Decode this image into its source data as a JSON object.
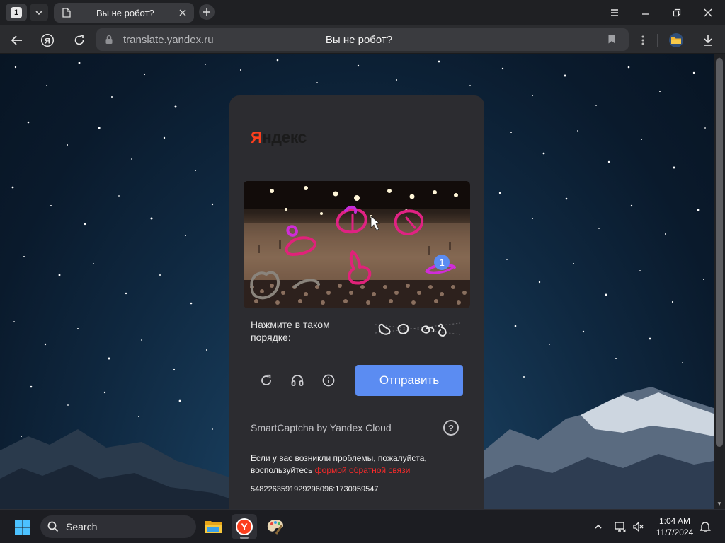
{
  "browser": {
    "tab_count": "1",
    "tab_title": "Вы не робот?",
    "url": "translate.yandex.ru",
    "page_heading": "Вы не робот?"
  },
  "captcha": {
    "logo": {
      "first_letter": "Я",
      "rest": "ндекс"
    },
    "instruction": "Нажмите в таком порядке:",
    "submit_label": "Отправить",
    "brand": "SmartCaptcha by Yandex Cloud",
    "help_symbol": "?",
    "click_marker": "1",
    "feedback_text": "Если у вас возникли проблемы, пожалуйста, воспользуйтесь",
    "feedback_link": "формой обратной связи",
    "token": "5482263591929296096:1730959547"
  },
  "taskbar": {
    "search_label": "Search",
    "time": "1:04 AM",
    "date": "11/7/2024"
  },
  "colors": {
    "accent": "#5b8cf2",
    "logo_red": "#fc3f1d",
    "link_red": "#ff2a2a",
    "card_bg": "#2c2c30"
  }
}
